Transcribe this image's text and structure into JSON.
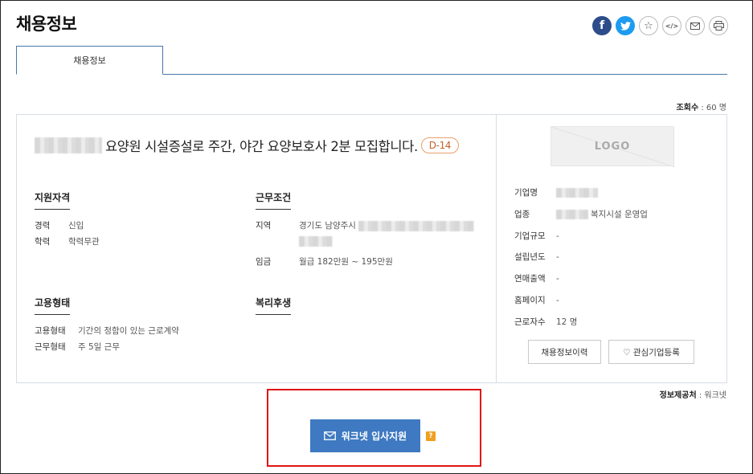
{
  "page": {
    "title": "채용정보"
  },
  "share": [
    {
      "name": "facebook-share-button",
      "icon": "facebook-icon",
      "glyph": "f",
      "color": "#2d4d8a"
    },
    {
      "name": "twitter-share-button",
      "icon": "twitter-icon",
      "glyph": "",
      "color": "#1d9bf0"
    },
    {
      "name": "bookmark-star-button",
      "icon": "star-icon",
      "glyph": "☆"
    },
    {
      "name": "embed-code-button",
      "icon": "code-icon",
      "glyph": "</>"
    },
    {
      "name": "email-share-button",
      "icon": "mail-icon",
      "glyph": "✉"
    },
    {
      "name": "print-button",
      "icon": "printer-icon",
      "glyph": "⎙"
    }
  ],
  "tabs": [
    {
      "label": "채용정보",
      "active": true
    }
  ],
  "stats": {
    "views_label": "조회수",
    "views_value": ": 60 명"
  },
  "job": {
    "title": "요양원 시설증설로 주간, 야간 요양보호사 2분 모집합니다.",
    "dday": "D-14"
  },
  "qualification": {
    "title": "지원자격",
    "rows": [
      {
        "k": "경력",
        "v": "신입"
      },
      {
        "k": "학력",
        "v": "학력무관"
      }
    ]
  },
  "conditions": {
    "title": "근무조건",
    "region_label": "지역",
    "region_value": "경기도 남양주시",
    "wage_label": "임금",
    "wage_value": "월급 182만원 ~ 195만원"
  },
  "employment": {
    "title": "고용형태",
    "rows": [
      {
        "k": "고용형태",
        "v": "기간의 정함이 있는 근로계약"
      },
      {
        "k": "근무형태",
        "v": "주 5일 근무"
      }
    ]
  },
  "welfare": {
    "title": "복리후생"
  },
  "company": {
    "logo_text": "LOGO",
    "rows": [
      {
        "k": "기업명",
        "v": ""
      },
      {
        "k": "업종",
        "v": "복지시설 운영업"
      },
      {
        "k": "기업규모",
        "v": "-"
      },
      {
        "k": "설립년도",
        "v": "-"
      },
      {
        "k": "연매출액",
        "v": "-"
      },
      {
        "k": "홈페이지",
        "v": "-"
      },
      {
        "k": "근로자수",
        "v": "12 명"
      }
    ],
    "history_button": "채용정보이력",
    "interest_button": "♡ 관심기업등록"
  },
  "source": {
    "label": "정보제공처",
    "value": ": 워크넷"
  },
  "apply": {
    "label": "워크넷 입사지원",
    "help": "?"
  },
  "colors": {
    "accent": "#3e79c2",
    "highlight": "#e01414",
    "dday": "#c0622a"
  }
}
